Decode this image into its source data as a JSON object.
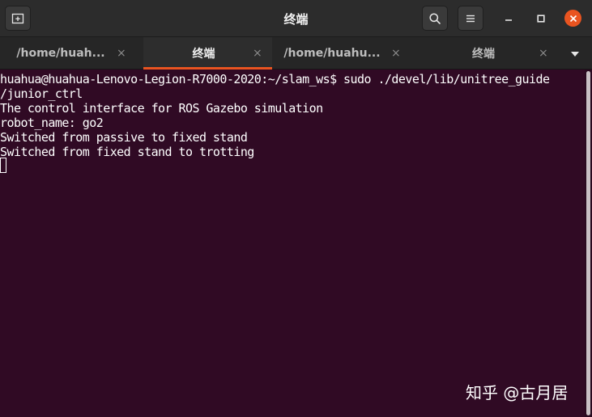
{
  "window": {
    "title": "终端",
    "buttons": {
      "new_tab_icon": "new-tab-icon",
      "search_icon": "search-icon",
      "menu_icon": "hamburger-menu-icon",
      "minimize_icon": "minimize-icon",
      "maximize_icon": "maximize-icon",
      "close_icon": "close-icon"
    },
    "accent_color": "#e95420"
  },
  "tabs": [
    {
      "label": "/home/huah...",
      "active": false
    },
    {
      "label": "终端",
      "active": true
    },
    {
      "label": "/home/huahu...",
      "active": false
    },
    {
      "label": "终端",
      "active": false
    }
  ],
  "tab_close_glyph": "×",
  "terminal": {
    "background": "#300a24",
    "lines": [
      "huahua@huahua-Lenovo-Legion-R7000-2020:~/slam_ws$ sudo ./devel/lib/unitree_guide",
      "/junior_ctrl",
      "The control interface for ROS Gazebo simulation",
      "robot_name: go2",
      "Switched from passive to fixed stand",
      "Switched from fixed stand to trotting"
    ]
  },
  "watermark": "知乎 @古月居"
}
